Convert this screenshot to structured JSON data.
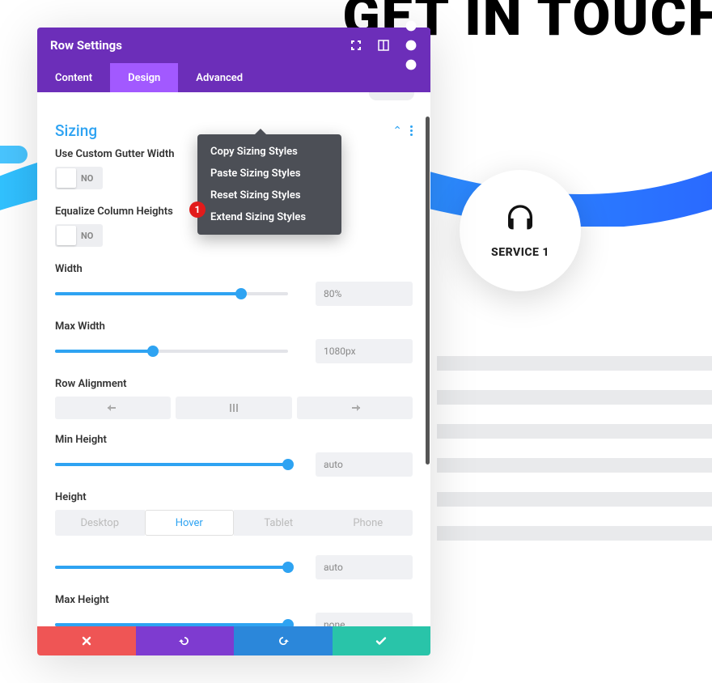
{
  "bg": {
    "title": "GET IN TOUCH",
    "service_label": "SERVICE 1"
  },
  "panel": {
    "title": "Row Settings",
    "tabs": {
      "content": "Content",
      "design": "Design",
      "advanced": "Advanced"
    }
  },
  "section": {
    "title": "Sizing",
    "custom_gutter_label": "Use Custom Gutter Width",
    "custom_gutter_value": "NO",
    "equalize_label": "Equalize Column Heights",
    "equalize_value": "NO",
    "width_label": "Width",
    "width_value": "80%",
    "width_pct": 80,
    "max_width_label": "Max Width",
    "max_width_value": "1080px",
    "max_width_pct": 42,
    "row_align_label": "Row Alignment",
    "min_height_label": "Min Height",
    "min_height_value": "auto",
    "min_height_pct": 100,
    "height_label": "Height",
    "height_value": "auto",
    "height_pct": 100,
    "max_height_label": "Max Height",
    "max_height_value": "none",
    "max_height_pct": 100
  },
  "device_tabs": {
    "desktop": "Desktop",
    "hover": "Hover",
    "tablet": "Tablet",
    "phone": "Phone"
  },
  "menu": {
    "copy": "Copy Sizing Styles",
    "paste": "Paste Sizing Styles",
    "reset": "Reset Sizing Styles",
    "extend": "Extend Sizing Styles"
  },
  "badge": "1"
}
